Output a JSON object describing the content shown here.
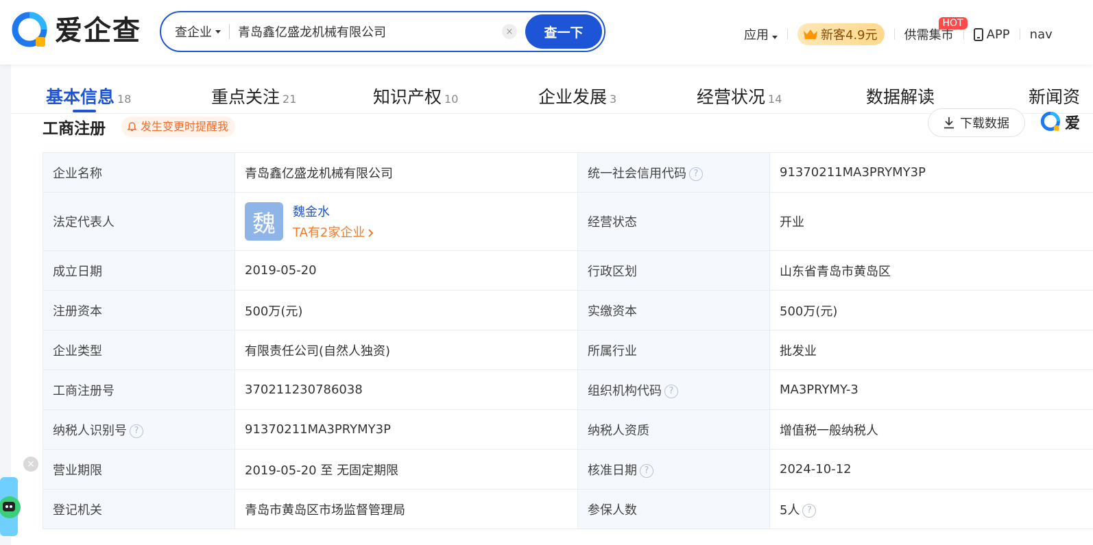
{
  "logo": {
    "text": "爱企查"
  },
  "search": {
    "type_label": "查企业",
    "query": "青岛鑫亿盛龙机械有限公司",
    "clear_symbol": "×",
    "button_label": "查一下"
  },
  "topnav": {
    "apps": "应用",
    "vip_promo": "新客4.9元",
    "market": "供需集市",
    "hot_badge": "HOT",
    "app": "APP",
    "nav_partial": "nav"
  },
  "tabs": [
    {
      "label": "基本信息",
      "count": "18"
    },
    {
      "label": "重点关注",
      "count": "21"
    },
    {
      "label": "知识产权",
      "count": "10"
    },
    {
      "label": "企业发展",
      "count": "3"
    },
    {
      "label": "经营状况",
      "count": "14"
    },
    {
      "label": "数据解读",
      "count": ""
    },
    {
      "label": "新闻资",
      "count": ""
    }
  ],
  "section": {
    "title": "工商注册",
    "remind": "发生变更时提醒我",
    "download": "下载数据",
    "mini_logo": "爱"
  },
  "table": {
    "rows": [
      {
        "l1": "企业名称",
        "v1": "青岛鑫亿盛龙机械有限公司",
        "l2": "统一社会信用代码",
        "v2": "91370211MA3PRYMY3P"
      },
      {
        "l1": "法定代表人",
        "v1": "",
        "l2": "经营状态",
        "v2": "开业"
      },
      {
        "l1": "成立日期",
        "v1": "2019-05-20",
        "l2": "行政区划",
        "v2": "山东省青岛市黄岛区"
      },
      {
        "l1": "注册资本",
        "v1": "500万(元)",
        "l2": "实缴资本",
        "v2": "500万(元)"
      },
      {
        "l1": "企业类型",
        "v1": "有限责任公司(自然人独资)",
        "l2": "所属行业",
        "v2": "批发业"
      },
      {
        "l1": "工商注册号",
        "v1": "370211230786038",
        "l2": "组织机构代码",
        "v2": "MA3PRYMY-3"
      },
      {
        "l1": "纳税人识别号",
        "v1": "91370211MA3PRYMY3P",
        "l2": "纳税人资质",
        "v2": "增值税一般纳税人"
      },
      {
        "l1": "营业期限",
        "v1": "2019-05-20 至 无固定期限",
        "l2": "核准日期",
        "v2": "2024-10-12"
      },
      {
        "l1": "登记机关",
        "v1": "青岛市黄岛区市场监督管理局",
        "l2": "参保人数",
        "v2": "5人"
      }
    ],
    "legal_rep": {
      "avatar_char": "魏",
      "name": "魏金水",
      "link": "TA有2家企业"
    },
    "help_symbol": "?"
  },
  "float": {
    "close_symbol": "×"
  },
  "colors": {
    "brand_blue": "#1e55d6",
    "accent_orange": "#f07c2a",
    "hot_red": "#ff4a4a"
  }
}
